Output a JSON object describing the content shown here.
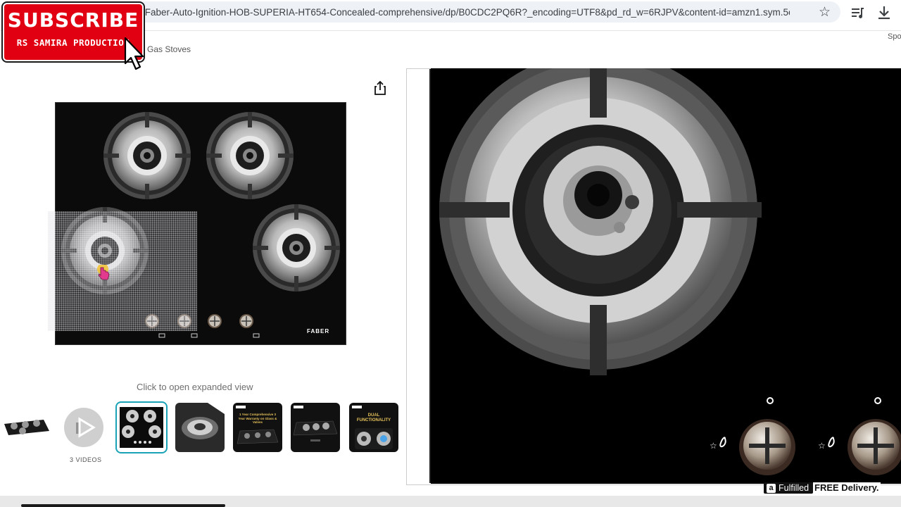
{
  "browser": {
    "url": "/Faber-Auto-Ignition-HOB-SUPERIA-HT654-Concealed-comprehensive/dp/B0CDC2PQ6R?_encoding=UTF8&pd_rd_w=6RJPV&content-id=amzn1.sym.5e...",
    "icons": [
      "star-icon",
      "reading-list-icon",
      "download-icon"
    ]
  },
  "overlay": {
    "subscribe_title": "SUBSCRIBE",
    "subscribe_subtitle": "RS SAMIRA PRODUCTION"
  },
  "page": {
    "breadcrumb": "Gas Stoves",
    "sponsored_partial": "Spo"
  },
  "gallery": {
    "open_hint": "Click to open expanded view",
    "video_label": "3 VIDEOS",
    "selected_index": 2,
    "main_image": {
      "brand_mark": "FABER",
      "burners": 4,
      "knobs": 4
    },
    "thumbnails": [
      {
        "kind": "product",
        "caption": ""
      },
      {
        "kind": "video",
        "caption": ""
      },
      {
        "kind": "product-top",
        "caption": ""
      },
      {
        "kind": "burner-closeup",
        "caption": ""
      },
      {
        "kind": "warranty",
        "caption": "1 Year Comprehensive 3 Year Warranty on Glass & Valves"
      },
      {
        "kind": "product-dark",
        "caption": ""
      },
      {
        "kind": "dual",
        "caption": "DUAL FUNCTIONALITY"
      }
    ]
  },
  "zoom": {
    "fulfilled_label": "Fulfilled",
    "delivery_label": "FREE Delivery."
  },
  "colors": {
    "subscribe_red": "#e10012",
    "selected_border": "#1aa3b6",
    "url_background": "#eef1f6"
  }
}
